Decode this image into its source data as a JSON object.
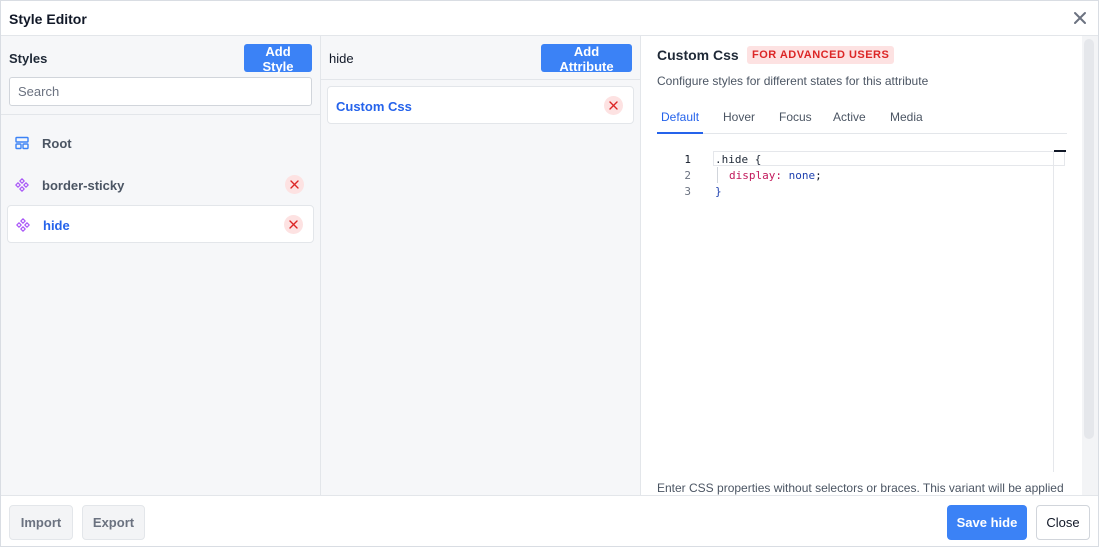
{
  "header": {
    "title": "Style Editor",
    "close_icon": "close-icon"
  },
  "styles_panel": {
    "title": "Styles",
    "add_button": "Add Style",
    "search_placeholder": "Search",
    "items": [
      {
        "name": "Root",
        "icon": "layout-grid-icon",
        "removable": false,
        "active": false
      },
      {
        "name": "border-sticky",
        "icon": "component-icon",
        "removable": true,
        "active": false
      },
      {
        "name": "hide",
        "icon": "component-icon",
        "removable": true,
        "active": true
      }
    ]
  },
  "attributes_panel": {
    "title": "hide",
    "add_button": "Add Attribute",
    "items": [
      {
        "name": "Custom Css",
        "removable": true
      }
    ]
  },
  "editor": {
    "title": "Custom Css",
    "badge": "FOR ADVANCED USERS",
    "description": "Configure styles for different states for this attribute",
    "tabs": [
      "Default",
      "Hover",
      "Focus",
      "Active",
      "Media"
    ],
    "active_tab": "Default",
    "code": {
      "line_numbers": [
        "1",
        "2",
        "3"
      ],
      "line1": ".hide {",
      "line2_prop": "display:",
      "line2_value": "none",
      "line2_end": ";",
      "line3": "}"
    },
    "help_text": "Enter CSS properties without selectors or braces. This variant will be applied"
  },
  "footer": {
    "import": "Import",
    "export": "Export",
    "save": "Save hide",
    "close": "Close"
  },
  "colors": {
    "primary": "#3b82f6",
    "active_text": "#2563eb",
    "danger_bg": "#fde2e2",
    "danger": "#dc2626",
    "icon_purple": "#a855f7"
  }
}
